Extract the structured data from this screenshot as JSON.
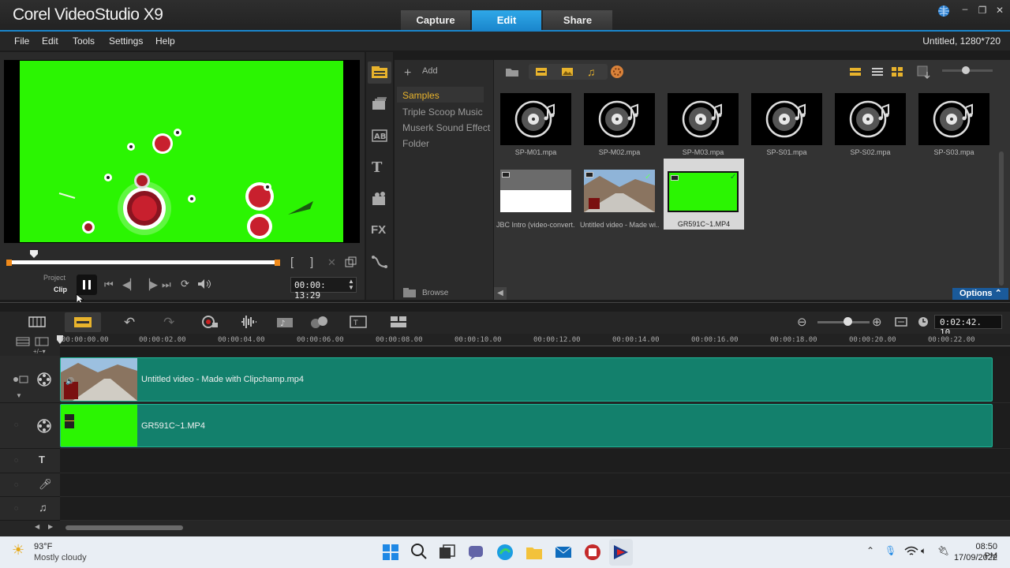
{
  "app": {
    "title": "Corel VideoStudio X9"
  },
  "modes": {
    "capture": "Capture",
    "edit": "Edit",
    "share": "Share"
  },
  "menu": {
    "file": "File",
    "edit": "Edit",
    "tools": "Tools",
    "settings": "Settings",
    "help": "Help"
  },
  "project_info": "Untitled, 1280*720",
  "player": {
    "project_label": "Project",
    "clip_label": "Clip",
    "timecode": "00:00: 13:29"
  },
  "library": {
    "add_label": "Add",
    "browse_label": "Browse",
    "options_label": "Options",
    "nav_items": [
      "Samples",
      "Triple Scoop Music",
      "Muserk Sound Effect",
      "Folder"
    ],
    "thumbnails": [
      {
        "label": "SP-M01.mpa",
        "kind": "audio"
      },
      {
        "label": "SP-M02.mpa",
        "kind": "audio"
      },
      {
        "label": "SP-M03.mpa",
        "kind": "audio"
      },
      {
        "label": "SP-S01.mpa",
        "kind": "audio"
      },
      {
        "label": "SP-S02.mpa",
        "kind": "audio"
      },
      {
        "label": "SP-S03.mpa",
        "kind": "audio"
      },
      {
        "label": "JBC Intro (video-convert...",
        "kind": "video-white"
      },
      {
        "label": "Untitled video - Made wi...",
        "kind": "video-road"
      },
      {
        "label": "GR591C~1.MP4",
        "kind": "video-green"
      }
    ]
  },
  "timeline": {
    "duration": "0:02:42. 10",
    "ruler": [
      "00:00:00.00",
      "00:00:02.00",
      "00:00:04.00",
      "00:00:06.00",
      "00:00:08.00",
      "00:00:10.00",
      "00:00:12.00",
      "00:00:14.00",
      "00:00:16.00",
      "00:00:18.00",
      "00:00:20.00",
      "00:00:22.00"
    ],
    "clips": {
      "video": "Untitled video - Made with Clipchamp.mp4",
      "overlay": "GR591C~1.MP4"
    }
  },
  "taskbar": {
    "weather_temp": "93°F",
    "weather_desc": "Mostly cloudy",
    "time": "08:50 PM",
    "date": "17/09/2022"
  },
  "colors": {
    "accent": "#1a86cc",
    "green_screen": "#2bf502",
    "clip": "#13806c",
    "highlight_text": "#e8b32c"
  }
}
